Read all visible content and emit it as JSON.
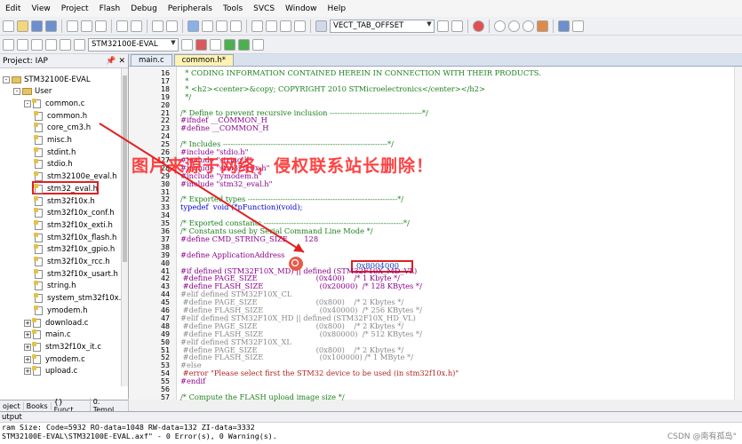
{
  "menu": [
    "Edit",
    "View",
    "Project",
    "Flash",
    "Debug",
    "Peripherals",
    "Tools",
    "SVCS",
    "Window",
    "Help"
  ],
  "toolbar": {
    "combo1": "VECT_TAB_OFFSET",
    "target_combo": "STM32100E-EVAL"
  },
  "project": {
    "title": "Project: IAP",
    "items": [
      {
        "label": "STM32100E-EVAL",
        "indent": 0,
        "type": "target",
        "exp": "-"
      },
      {
        "label": "User",
        "indent": 1,
        "type": "folder",
        "exp": "-"
      },
      {
        "label": "common.c",
        "indent": 2,
        "type": "c",
        "exp": "-"
      },
      {
        "label": "common.h",
        "indent": 3,
        "type": "h",
        "exp": ""
      },
      {
        "label": "core_cm3.h",
        "indent": 3,
        "type": "h",
        "exp": ""
      },
      {
        "label": "misc.h",
        "indent": 3,
        "type": "h",
        "exp": ""
      },
      {
        "label": "stdint.h",
        "indent": 3,
        "type": "h",
        "exp": ""
      },
      {
        "label": "stdio.h",
        "indent": 3,
        "type": "h",
        "exp": ""
      },
      {
        "label": "stm32100e_eval.h",
        "indent": 3,
        "type": "h",
        "exp": ""
      },
      {
        "label": "stm32_eval.h",
        "indent": 3,
        "type": "h",
        "exp": ""
      },
      {
        "label": "stm32f10x.h",
        "indent": 3,
        "type": "h",
        "exp": ""
      },
      {
        "label": "stm32f10x_conf.h",
        "indent": 3,
        "type": "h",
        "exp": ""
      },
      {
        "label": "stm32f10x_exti.h",
        "indent": 3,
        "type": "h",
        "exp": ""
      },
      {
        "label": "stm32f10x_flash.h",
        "indent": 3,
        "type": "h",
        "exp": ""
      },
      {
        "label": "stm32f10x_gpio.h",
        "indent": 3,
        "type": "h",
        "exp": ""
      },
      {
        "label": "stm32f10x_rcc.h",
        "indent": 3,
        "type": "h",
        "exp": ""
      },
      {
        "label": "stm32f10x_usart.h",
        "indent": 3,
        "type": "h",
        "exp": ""
      },
      {
        "label": "string.h",
        "indent": 3,
        "type": "h",
        "exp": ""
      },
      {
        "label": "system_stm32f10x.h",
        "indent": 3,
        "type": "h",
        "exp": ""
      },
      {
        "label": "ymodem.h",
        "indent": 3,
        "type": "h",
        "exp": ""
      },
      {
        "label": "download.c",
        "indent": 2,
        "type": "c",
        "exp": "+"
      },
      {
        "label": "main.c",
        "indent": 2,
        "type": "c",
        "exp": "+"
      },
      {
        "label": "stm32f10x_it.c",
        "indent": 2,
        "type": "c",
        "exp": "+"
      },
      {
        "label": "ymodem.c",
        "indent": 2,
        "type": "c",
        "exp": "+"
      },
      {
        "label": "upload.c",
        "indent": 2,
        "type": "c",
        "exp": "+"
      }
    ],
    "tabs": [
      "oject",
      "Books",
      "{} Funct...",
      "0. Templ..."
    ]
  },
  "editor": {
    "tabs": [
      {
        "label": "main.c",
        "active": false
      },
      {
        "label": "common.h*",
        "active": true
      }
    ],
    "highlight_value": "0x8004000",
    "lines": [
      {
        "n": "16",
        "t": "  * CODING INFORMATION CONTAINED HEREIN IN CONNECTION WITH THEIR PRODUCTS.",
        "c": "cm"
      },
      {
        "n": "17",
        "t": "  *",
        "c": "cm"
      },
      {
        "n": "18",
        "t": "  * <h2><center>&copy; COPYRIGHT 2010 STMicroelectronics</center></h2>",
        "c": "cm"
      },
      {
        "n": "19",
        "t": "  */",
        "c": "cm"
      },
      {
        "n": "20",
        "t": "",
        "c": "nm"
      },
      {
        "n": "21",
        "t": "/* Define to prevent recursive inclusion -------------------------------------*/",
        "c": "cm"
      },
      {
        "n": "22",
        "t": "#ifndef __COMMON_H",
        "c": "pp"
      },
      {
        "n": "23",
        "t": "#define __COMMON_H",
        "c": "pp"
      },
      {
        "n": "24",
        "t": "",
        "c": "nm"
      },
      {
        "n": "25",
        "t": "/* Includes ------------------------------------------------------------------*/",
        "c": "cm"
      },
      {
        "n": "26",
        "t": "#include \"stdio.h\"",
        "c": "pp"
      },
      {
        "n": "27",
        "t": "#include \"string.h\"",
        "c": "pp"
      },
      {
        "n": "28",
        "t": "#include \"stm32f10x.h\"",
        "c": "pp"
      },
      {
        "n": "29",
        "t": "#include \"ymodem.h\"",
        "c": "pp"
      },
      {
        "n": "30",
        "t": "#include \"stm32_eval.h\"",
        "c": "pp"
      },
      {
        "n": "31",
        "t": "",
        "c": "nm"
      },
      {
        "n": "32",
        "t": "/* Exported types ------------------------------------------------------------*/",
        "c": "cm"
      },
      {
        "n": "33",
        "t": "typedef  void (*pFunction)(void);",
        "c": "kw"
      },
      {
        "n": "34",
        "t": "",
        "c": "nm"
      },
      {
        "n": "35",
        "t": "/* Exported constants --------------------------------------------------------*/",
        "c": "cm"
      },
      {
        "n": "36",
        "t": "/* Constants used by Serial Command Line Mode */",
        "c": "cm"
      },
      {
        "n": "37",
        "t": "#define CMD_STRING_SIZE       128",
        "c": "pp"
      },
      {
        "n": "38",
        "t": "",
        "c": "nm"
      },
      {
        "n": "39",
        "t": "#define ApplicationAddress",
        "c": "pp"
      },
      {
        "n": "40",
        "t": "",
        "c": "nm"
      },
      {
        "n": "41",
        "t": "#if defined (STM32F10X_MD) || defined (STM32F10X_MD_VL)",
        "c": "pp"
      },
      {
        "n": "42",
        "t": " #define PAGE_SIZE                         (0x400)    /* 1 Kbyte */",
        "c": "pp"
      },
      {
        "n": "43",
        "t": " #define FLASH_SIZE                        (0x20000)  /* 128 KBytes */",
        "c": "pp"
      },
      {
        "n": "44",
        "t": "#elif defined STM32F10X_CL",
        "c": "gr"
      },
      {
        "n": "45",
        "t": " #define PAGE_SIZE                         (0x800)    /* 2 Kbytes */",
        "c": "gr"
      },
      {
        "n": "46",
        "t": " #define FLASH_SIZE                        (0x40000)  /* 256 KBytes */",
        "c": "gr"
      },
      {
        "n": "47",
        "t": "#elif defined STM32F10X_HD || defined (STM32F10X_HD_VL)",
        "c": "gr"
      },
      {
        "n": "48",
        "t": " #define PAGE_SIZE                         (0x800)    /* 2 Kbytes */",
        "c": "gr"
      },
      {
        "n": "49",
        "t": " #define FLASH_SIZE                        (0x80000)  /* 512 KBytes */",
        "c": "gr"
      },
      {
        "n": "50",
        "t": "#elif defined STM32F10X_XL",
        "c": "gr"
      },
      {
        "n": "51",
        "t": " #define PAGE_SIZE                         (0x800)    /* 2 Kbytes */",
        "c": "gr"
      },
      {
        "n": "52",
        "t": " #define FLASH_SIZE                        (0x100000) /* 1 MByte */",
        "c": "gr"
      },
      {
        "n": "53",
        "t": "#else",
        "c": "gr"
      },
      {
        "n": "54",
        "t": " #error \"Please select first the STM32 device to be used (in stm32f10x.h)\"",
        "c": "st"
      },
      {
        "n": "55",
        "t": "#endif",
        "c": "pp"
      },
      {
        "n": "56",
        "t": "",
        "c": "nm"
      },
      {
        "n": "57",
        "t": "/* Compute the FLASH upload image size */",
        "c": "cm"
      }
    ]
  },
  "watermark": "图片来源于网络，侵权联系站长删除！",
  "output": {
    "title": "utput",
    "lines": [
      "ram Size: Code=5932 RO-data=1048 RW-data=132 ZI-data=3332",
      "STM32100E-EVAL\\STM32100E-EVAL.axf\" - 0 Error(s), 0 Warning(s)."
    ]
  },
  "credit": "CSDN @南有孤岛°"
}
